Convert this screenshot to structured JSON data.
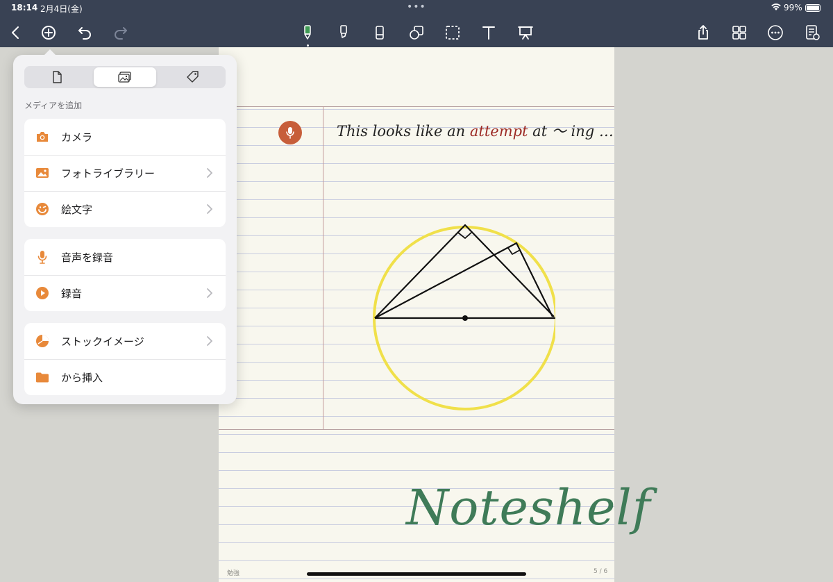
{
  "status": {
    "time": "18:14",
    "date": "2月4日(金)",
    "battery": "99%"
  },
  "toolbar": {
    "left": [
      "back-icon",
      "add-icon",
      "undo-icon",
      "redo-icon"
    ],
    "center": [
      "pen-icon",
      "highlighter-icon",
      "eraser-icon",
      "shapes-icon",
      "lasso-icon",
      "text-icon",
      "presenter-icon"
    ],
    "right": [
      "share-icon",
      "grid-icon",
      "more-icon",
      "notebook-settings-icon"
    ],
    "accent": "#3f9a54"
  },
  "popover": {
    "tabs": [
      "page-icon",
      "media-icon",
      "tag-icon"
    ],
    "selected_tab": 1,
    "section_title": "メディアを追加",
    "groups": [
      [
        {
          "label": "カメラ",
          "icon": "camera-icon",
          "chevron": false
        },
        {
          "label": "フォトライブラリー",
          "icon": "photo-library-icon",
          "chevron": true
        },
        {
          "label": "絵文字",
          "icon": "emoji-icon",
          "chevron": true
        }
      ],
      [
        {
          "label": "音声を録音",
          "icon": "microphone-icon",
          "chevron": false
        },
        {
          "label": "録音",
          "icon": "play-recording-icon",
          "chevron": true
        }
      ],
      [
        {
          "label": "ストックイメージ",
          "icon": "stock-image-icon",
          "chevron": true
        },
        {
          "label": "から挿入",
          "icon": "folder-icon",
          "chevron": false
        }
      ]
    ],
    "icon_color": "#e8893a"
  },
  "page": {
    "handwriting": {
      "before": "This looks like an ",
      "highlight": "attempt",
      "after": " at ～ ing …"
    },
    "brand": "Noteshelf",
    "footer_left": "勉強",
    "footer_right": "5 / 6",
    "circle_color": "#f0e04a"
  }
}
